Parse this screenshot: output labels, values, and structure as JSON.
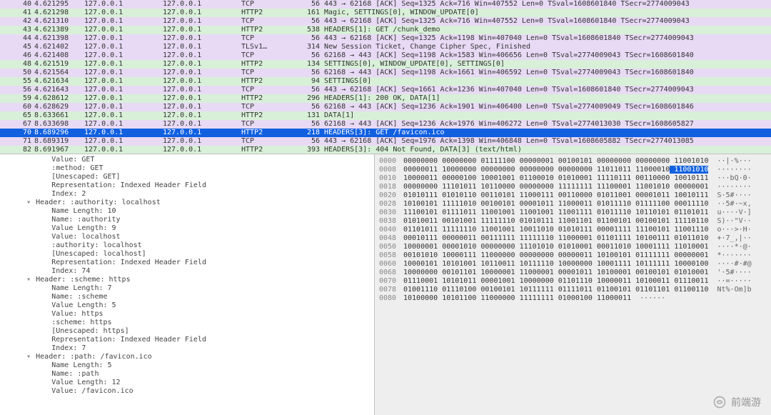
{
  "packet_columns": [
    "No.",
    "Time",
    "Source",
    "Destination",
    "Protocol",
    "Length",
    "Info"
  ],
  "packets": [
    {
      "no": 40,
      "time": "4.621295",
      "src": "127.0.0.1",
      "dst": "127.0.0.1",
      "proto": "TCP",
      "len": 56,
      "cls": "purple",
      "info": "443 → 62168 [ACK] Seq=1325 Ack=716 Win=407552 Len=0 TSval=1608601840 TSecr=2774009043"
    },
    {
      "no": 41,
      "time": "4.621298",
      "src": "127.0.0.1",
      "dst": "127.0.0.1",
      "proto": "HTTP2",
      "len": 161,
      "cls": "green",
      "info": "Magic, SETTINGS[0], WINDOW_UPDATE[0]"
    },
    {
      "no": 42,
      "time": "4.621310",
      "src": "127.0.0.1",
      "dst": "127.0.0.1",
      "proto": "TCP",
      "len": 56,
      "cls": "purple",
      "info": "443 → 62168 [ACK] Seq=1325 Ack=716 Win=407552 Len=0 TSval=1608601840 TSecr=2774009043"
    },
    {
      "no": 43,
      "time": "4.621389",
      "src": "127.0.0.1",
      "dst": "127.0.0.1",
      "proto": "HTTP2",
      "len": 538,
      "cls": "green",
      "info": "HEADERS[1]: GET /chunk_demo"
    },
    {
      "no": 44,
      "time": "4.621398",
      "src": "127.0.0.1",
      "dst": "127.0.0.1",
      "proto": "TCP",
      "len": 56,
      "cls": "purple",
      "info": "443 → 62168 [ACK] Seq=1325 Ack=1198 Win=407040 Len=0 TSval=1608601840 TSecr=2774009043"
    },
    {
      "no": 45,
      "time": "4.621402",
      "src": "127.0.0.1",
      "dst": "127.0.0.1",
      "proto": "TLSv1…",
      "len": 314,
      "cls": "purple",
      "info": "New Session Ticket, Change Cipher Spec, Finished"
    },
    {
      "no": 46,
      "time": "4.621408",
      "src": "127.0.0.1",
      "dst": "127.0.0.1",
      "proto": "TCP",
      "len": 56,
      "cls": "purple",
      "info": "62168 → 443 [ACK] Seq=1198 Ack=1583 Win=406656 Len=0 TSval=2774009043 TSecr=1608601840"
    },
    {
      "no": 48,
      "time": "4.621519",
      "src": "127.0.0.1",
      "dst": "127.0.0.1",
      "proto": "HTTP2",
      "len": 134,
      "cls": "green",
      "info": "SETTINGS[0], WINDOW_UPDATE[0], SETTINGS[0]"
    },
    {
      "no": 50,
      "time": "4.621564",
      "src": "127.0.0.1",
      "dst": "127.0.0.1",
      "proto": "TCP",
      "len": 56,
      "cls": "purple",
      "info": "62168 → 443 [ACK] Seq=1198 Ack=1661 Win=406592 Len=0 TSval=2774009043 TSecr=1608601840"
    },
    {
      "no": 55,
      "time": "4.621634",
      "src": "127.0.0.1",
      "dst": "127.0.0.1",
      "proto": "HTTP2",
      "len": 94,
      "cls": "green",
      "info": "SETTINGS[0]"
    },
    {
      "no": 56,
      "time": "4.621643",
      "src": "127.0.0.1",
      "dst": "127.0.0.1",
      "proto": "TCP",
      "len": 56,
      "cls": "purple",
      "info": "443 → 62168 [ACK] Seq=1661 Ack=1236 Win=407040 Len=0 TSval=1608601840 TSecr=2774009043"
    },
    {
      "no": 59,
      "time": "4.628612",
      "src": "127.0.0.1",
      "dst": "127.0.0.1",
      "proto": "HTTP2",
      "len": 296,
      "cls": "green",
      "info": "HEADERS[1]: 200 OK, DATA[1]"
    },
    {
      "no": 60,
      "time": "4.628629",
      "src": "127.0.0.1",
      "dst": "127.0.0.1",
      "proto": "TCP",
      "len": 56,
      "cls": "purple",
      "info": "62168 → 443 [ACK] Seq=1236 Ack=1901 Win=406400 Len=0 TSval=2774009049 TSecr=1608601846"
    },
    {
      "no": 65,
      "time": "8.633661",
      "src": "127.0.0.1",
      "dst": "127.0.0.1",
      "proto": "HTTP2",
      "len": 131,
      "cls": "green",
      "info": "DATA[1]"
    },
    {
      "no": 67,
      "time": "8.633698",
      "src": "127.0.0.1",
      "dst": "127.0.0.1",
      "proto": "TCP",
      "len": 56,
      "cls": "purple",
      "info": "62168 → 443 [ACK] Seq=1236 Ack=1976 Win=406272 Len=0 TSval=2774013030 TSecr=1608605827"
    },
    {
      "no": 70,
      "time": "8.689296",
      "src": "127.0.0.1",
      "dst": "127.0.0.1",
      "proto": "HTTP2",
      "len": 218,
      "cls": "selected",
      "info": "HEADERS[3]: GET /favicon.ico"
    },
    {
      "no": 71,
      "time": "8.689319",
      "src": "127.0.0.1",
      "dst": "127.0.0.1",
      "proto": "TCP",
      "len": 56,
      "cls": "purple",
      "info": "443 → 62168 [ACK] Seq=1976 Ack=1398 Win=406848 Len=0 TSval=1608605882 TSecr=2774013085"
    },
    {
      "no": 82,
      "time": "8.691967",
      "src": "127.0.0.1",
      "dst": "127.0.0.1",
      "proto": "HTTP2",
      "len": 393,
      "cls": "green",
      "info": "HEADERS[3]: 404 Not Found, DATA[3] (text/html)"
    }
  ],
  "details": [
    {
      "indent": 3,
      "twisty": "",
      "text": "Value: GET"
    },
    {
      "indent": 3,
      "twisty": "",
      "text": ":method: GET"
    },
    {
      "indent": 3,
      "twisty": "",
      "text": "[Unescaped: GET]"
    },
    {
      "indent": 3,
      "twisty": "",
      "text": "Representation: Indexed Header Field"
    },
    {
      "indent": 3,
      "twisty": "",
      "text": "Index: 2"
    },
    {
      "indent": 2,
      "twisty": "v",
      "text": "Header: :authority: localhost"
    },
    {
      "indent": 3,
      "twisty": "",
      "text": "Name Length: 10"
    },
    {
      "indent": 3,
      "twisty": "",
      "text": "Name: :authority"
    },
    {
      "indent": 3,
      "twisty": "",
      "text": "Value Length: 9"
    },
    {
      "indent": 3,
      "twisty": "",
      "text": "Value: localhost"
    },
    {
      "indent": 3,
      "twisty": "",
      "text": ":authority: localhost"
    },
    {
      "indent": 3,
      "twisty": "",
      "text": "[Unescaped: localhost]"
    },
    {
      "indent": 3,
      "twisty": "",
      "text": "Representation: Indexed Header Field"
    },
    {
      "indent": 3,
      "twisty": "",
      "text": "Index: 74"
    },
    {
      "indent": 2,
      "twisty": "v",
      "text": "Header: :scheme: https"
    },
    {
      "indent": 3,
      "twisty": "",
      "text": "Name Length: 7"
    },
    {
      "indent": 3,
      "twisty": "",
      "text": "Name: :scheme"
    },
    {
      "indent": 3,
      "twisty": "",
      "text": "Value Length: 5"
    },
    {
      "indent": 3,
      "twisty": "",
      "text": "Value: https"
    },
    {
      "indent": 3,
      "twisty": "",
      "text": ":scheme: https"
    },
    {
      "indent": 3,
      "twisty": "",
      "text": "[Unescaped: https]"
    },
    {
      "indent": 3,
      "twisty": "",
      "text": "Representation: Indexed Header Field"
    },
    {
      "indent": 3,
      "twisty": "",
      "text": "Index: 7"
    },
    {
      "indent": 2,
      "twisty": "v",
      "text": "Header: :path: /favicon.ico"
    },
    {
      "indent": 3,
      "twisty": "",
      "text": "Name Length: 5"
    },
    {
      "indent": 3,
      "twisty": "",
      "text": "Name: :path"
    },
    {
      "indent": 3,
      "twisty": "",
      "text": "Value Length: 12"
    },
    {
      "indent": 3,
      "twisty": "",
      "text": "Value: /favicon.ico"
    }
  ],
  "hex": [
    {
      "off": "0000",
      "bytes": [
        "00000000",
        "00000000",
        "01111100",
        "00000001",
        "00100101",
        "00000000",
        "00000000",
        "11001010"
      ],
      "sel": -1,
      "ascii": "··|·%···"
    },
    {
      "off": "0008",
      "bytes": [
        "00000011",
        "10000000",
        "00000000",
        "00000000",
        "00000000",
        "11011011",
        "11000010",
        "11001010"
      ],
      "sel": 7,
      "ascii": "········"
    },
    {
      "off": "0010",
      "bytes": [
        "10000011",
        "00000100",
        "10001001",
        "01100010",
        "01010001",
        "11110111",
        "00110000",
        "10010111"
      ],
      "sel": -1,
      "ascii": "···bQ·0·"
    },
    {
      "off": "0018",
      "bytes": [
        "00000000",
        "11101011",
        "10110000",
        "00000000",
        "11111111",
        "11100001",
        "11001010",
        "00000001"
      ],
      "sel": -1,
      "ascii": "········"
    },
    {
      "off": "0020",
      "bytes": [
        "01010111",
        "01010110",
        "00110101",
        "11000111",
        "00110000",
        "01011001",
        "00001011",
        "10010111"
      ],
      "sel": -1,
      "ascii": "S·5#····"
    },
    {
      "off": "0028",
      "bytes": [
        "10100101",
        "11111010",
        "00100101",
        "00001011",
        "11000011",
        "01011110",
        "01111100",
        "00011110"
      ],
      "sel": -1,
      "ascii": "··5#·~x,"
    },
    {
      "off": "0030",
      "bytes": [
        "11100101",
        "01111011",
        "11001001",
        "11001001",
        "11001111",
        "01011110",
        "10110101",
        "01101011"
      ],
      "sel": -1,
      "ascii": "u····V·]"
    },
    {
      "off": "0038",
      "bytes": [
        "01010011",
        "00101001",
        "11111110",
        "01010111",
        "11001101",
        "01100101",
        "00100101",
        "11110110"
      ],
      "sel": -1,
      "ascii": "S)··\"V··"
    },
    {
      "off": "0040",
      "bytes": [
        "01101011",
        "11111110",
        "11001001",
        "10011010",
        "01010111",
        "00001111",
        "11100101",
        "11001110"
      ],
      "sel": -1,
      "ascii": "o···>·H·"
    },
    {
      "off": "0048",
      "bytes": [
        "00010111",
        "00000011",
        "00111111",
        "11111110",
        "11000001",
        "01101111",
        "10100111",
        "01011010"
      ],
      "sel": -1,
      "ascii": "+·7_,|··"
    },
    {
      "off": "0050",
      "bytes": [
        "10000001",
        "00001010",
        "00000000",
        "11101010",
        "01010001",
        "00011010",
        "10001111",
        "11010001"
      ],
      "sel": -1,
      "ascii": "····*·@·"
    },
    {
      "off": "0058",
      "bytes": [
        "00101010",
        "10000111",
        "11000000",
        "00000000",
        "00000011",
        "10100101",
        "01111111",
        "00000001"
      ],
      "sel": -1,
      "ascii": "*·······"
    },
    {
      "off": "0060",
      "bytes": [
        "10000101",
        "10101001",
        "10110011",
        "10111110",
        "10000000",
        "10001111",
        "10111111",
        "10000100"
      ],
      "sel": -1,
      "ascii": "····#·#@"
    },
    {
      "off": "0068",
      "bytes": [
        "10000000",
        "00101101",
        "10000001",
        "11000001",
        "00001011",
        "10100001",
        "00100101",
        "01010001"
      ],
      "sel": -1,
      "ascii": "'·5#····"
    },
    {
      "off": "0070",
      "bytes": [
        "01110001",
        "10101011",
        "00001001",
        "10000000",
        "01101110",
        "10000011",
        "10100011",
        "01110011"
      ],
      "sel": -1,
      "ascii": "··=·····"
    },
    {
      "off": "0078",
      "bytes": [
        "01001110",
        "01110100",
        "00100101",
        "10111111",
        "01111011",
        "01100101",
        "01101101",
        "01100110"
      ],
      "sel": -1,
      "ascii": "Nt%·Om]b"
    },
    {
      "off": "0080",
      "bytes": [
        "10100000",
        "10101100",
        "11000000",
        "11111111",
        "01000100",
        "11000011",
        "",
        ""
      ],
      "sel": -1,
      "ascii": "······"
    }
  ],
  "watermark": {
    "label": "前端游"
  }
}
